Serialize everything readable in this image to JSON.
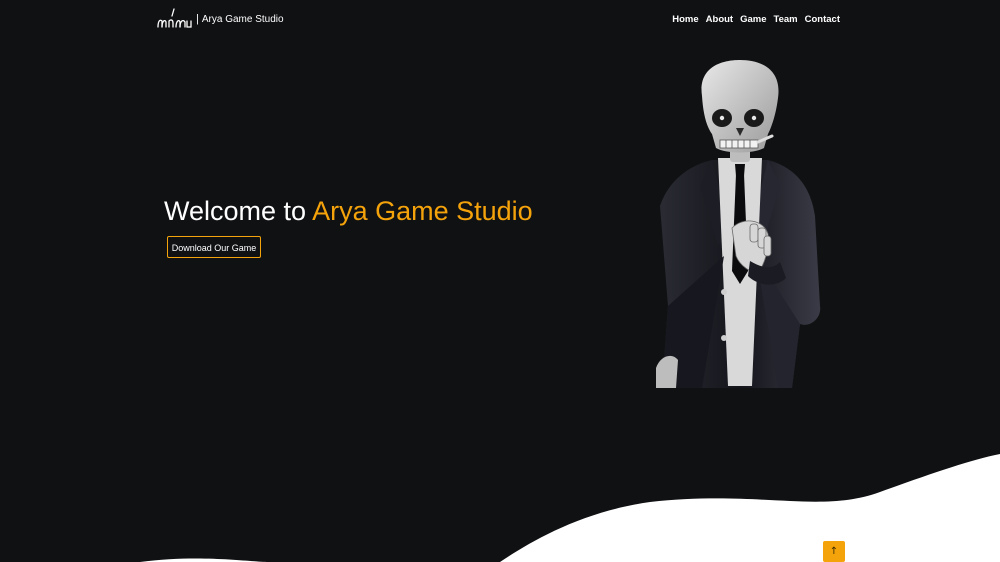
{
  "header": {
    "brand_separator": "|",
    "brand_name": "Arya Game Studio",
    "logo_icon": "arya-script-logo-icon"
  },
  "nav": {
    "items": [
      {
        "label": "Home"
      },
      {
        "label": "About"
      },
      {
        "label": "Game"
      },
      {
        "label": "Team"
      },
      {
        "label": "Contact"
      }
    ]
  },
  "hero": {
    "title_prefix": "Welcome to",
    "title_accent": "Arya Game Studio",
    "cta_label": "Download Our Game",
    "illustration_icon": "skeleton-in-suit-illustration"
  },
  "back_to_top": {
    "icon": "arrow-up-icon",
    "glyph": "↑"
  },
  "colors": {
    "background": "#101113",
    "accent": "#f5a30b",
    "text": "#ffffff",
    "wave": "#ffffff"
  }
}
